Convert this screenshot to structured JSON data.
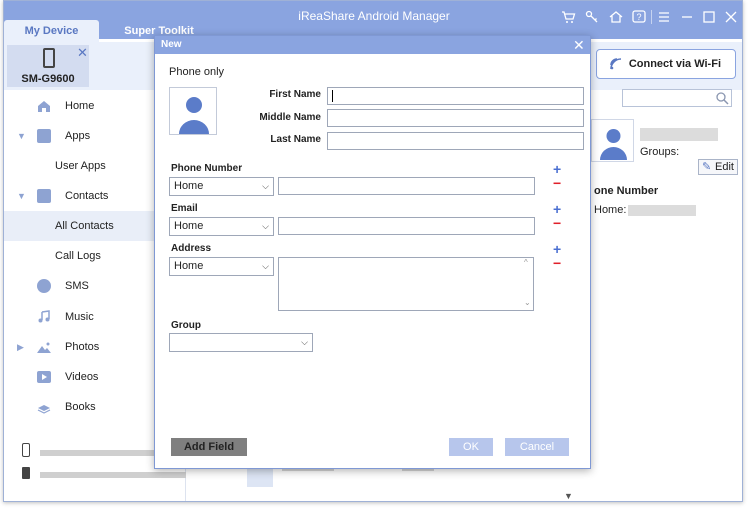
{
  "app": {
    "title": "iReaShare Android Manager",
    "tabs": [
      {
        "label": "My Device"
      },
      {
        "label": "Super Toolkit"
      }
    ],
    "titlebar_icons": [
      "cart-icon",
      "key-icon",
      "home-icon",
      "help-icon",
      "menu-icon",
      "minimize-icon",
      "maximize-icon",
      "close-icon"
    ],
    "accent_color": "#8aa4e0"
  },
  "device": {
    "name": "SM-G9600"
  },
  "sidebar": {
    "items": [
      {
        "label": "Home",
        "icon": "home-icon"
      },
      {
        "label": "Apps",
        "icon": "apps-icon"
      },
      {
        "label": "User Apps",
        "icon": ""
      },
      {
        "label": "Contacts",
        "icon": "contacts-icon"
      },
      {
        "label": "All Contacts",
        "icon": ""
      },
      {
        "label": "Call Logs",
        "icon": ""
      },
      {
        "label": "SMS",
        "icon": "sms-icon"
      },
      {
        "label": "Music",
        "icon": "music-icon"
      },
      {
        "label": "Photos",
        "icon": "photos-icon"
      },
      {
        "label": "Videos",
        "icon": "videos-icon"
      },
      {
        "label": "Books",
        "icon": "books-icon"
      }
    ]
  },
  "right_pane": {
    "connect_wifi_label": "Connect via Wi-Fi",
    "groups_label": "Groups:",
    "edit_label": "Edit",
    "phone_number_heading": "one Number",
    "home_label": "Home:"
  },
  "modal": {
    "title": "New",
    "phone_only": "Phone only",
    "fields": {
      "first_name": {
        "label": "First Name",
        "value": ""
      },
      "middle_name": {
        "label": "Middle Name",
        "value": ""
      },
      "last_name": {
        "label": "Last Name",
        "value": ""
      }
    },
    "phone_number": {
      "label": "Phone Number",
      "type": "Home",
      "value": ""
    },
    "email": {
      "label": "Email",
      "type": "Home",
      "value": ""
    },
    "address": {
      "label": "Address",
      "type": "Home",
      "value": ""
    },
    "group": {
      "label": "Group",
      "value": ""
    },
    "add_field_label": "Add Field",
    "ok_label": "OK",
    "cancel_label": "Cancel"
  }
}
